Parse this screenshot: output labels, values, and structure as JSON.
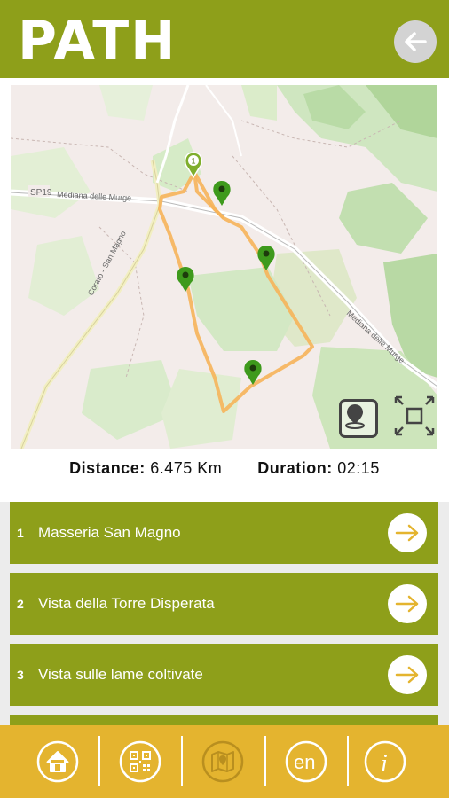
{
  "header": {
    "title": "PATH",
    "back_icon": "arrow-left-icon"
  },
  "map": {
    "road_labels": [
      "SP19",
      "Mediana delle Murge",
      "Corato - San Magno",
      "Mediana delle Murge"
    ],
    "start_marker_label": "1",
    "locate_icon": "map-pin-icon",
    "fullscreen_icon": "expand-icon"
  },
  "stats": {
    "distance_label": "Distance:",
    "distance_value": "6.475 Km",
    "duration_label": "Duration:",
    "duration_value": "02:15"
  },
  "poi_list": [
    {
      "number": "1",
      "name": "Masseria San Magno"
    },
    {
      "number": "2",
      "name": "Vista della Torre Disperata"
    },
    {
      "number": "3",
      "name": "Vista sulle lame coltivate"
    }
  ],
  "tabbar": {
    "en_label": "en",
    "info_label": "i",
    "icons": [
      "home-icon",
      "qr-code-icon",
      "map-icon",
      "language-icon",
      "info-icon"
    ]
  },
  "colors": {
    "header_green": "#8e9f1a",
    "route_orange": "#f6b45a",
    "tabbar_yellow": "#e4b42f",
    "marker_green": "#5aa31a"
  }
}
